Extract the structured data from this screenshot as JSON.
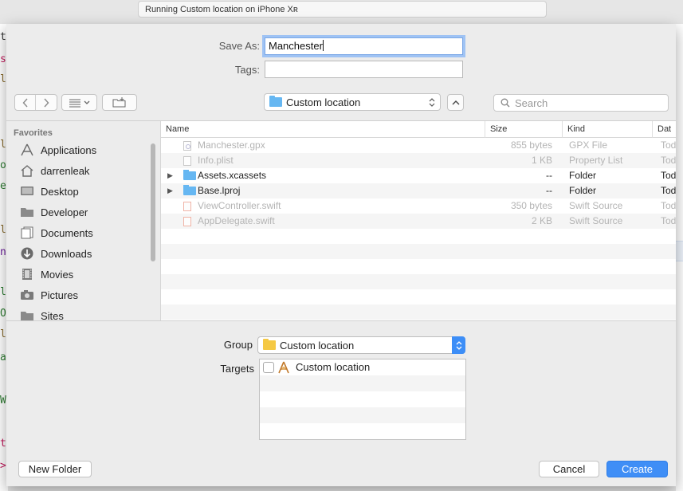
{
  "background_window": {
    "status_text": "Running Custom location on iPhone Xʀ",
    "editor_fragments": [
      "ti",
      "s",
      "lo",
      "",
      "lo",
      "ol",
      "e",
      "",
      "lo",
      "n",
      "",
      "l",
      "Op",
      "la",
      "a",
      "",
      "W",
      "",
      "t",
      ">"
    ]
  },
  "sheet": {
    "save_as_label": "Save As:",
    "save_as_value": "Manchester",
    "tags_label": "Tags:",
    "tags_value": "",
    "location_label": "Custom location",
    "search_placeholder": "Search"
  },
  "sidebar": {
    "heading": "Favorites",
    "items": [
      {
        "label": "Applications",
        "icon": "applications-icon"
      },
      {
        "label": "darrenleak",
        "icon": "home-icon"
      },
      {
        "label": "Desktop",
        "icon": "desktop-icon"
      },
      {
        "label": "Developer",
        "icon": "folder-icon"
      },
      {
        "label": "Documents",
        "icon": "documents-icon"
      },
      {
        "label": "Downloads",
        "icon": "downloads-icon"
      },
      {
        "label": "Movies",
        "icon": "movies-icon"
      },
      {
        "label": "Pictures",
        "icon": "pictures-icon"
      },
      {
        "label": "Sites",
        "icon": "folder-icon"
      }
    ]
  },
  "filelist": {
    "columns": [
      "Name",
      "Size",
      "Kind",
      "Dat"
    ],
    "rows": [
      {
        "name": "Manchester.gpx",
        "size": "855 bytes",
        "kind": "GPX File",
        "date": "Tod",
        "disabled": true,
        "folder": false
      },
      {
        "name": "Info.plist",
        "size": "1 KB",
        "kind": "Property List",
        "date": "Tod",
        "disabled": true,
        "folder": false
      },
      {
        "name": "Assets.xcassets",
        "size": "--",
        "kind": "Folder",
        "date": "Tod",
        "disabled": false,
        "folder": true
      },
      {
        "name": "Base.lproj",
        "size": "--",
        "kind": "Folder",
        "date": "Tod",
        "disabled": false,
        "folder": true
      },
      {
        "name": "ViewController.swift",
        "size": "350 bytes",
        "kind": "Swift Source",
        "date": "Tod",
        "disabled": true,
        "folder": false
      },
      {
        "name": "AppDelegate.swift",
        "size": "2 KB",
        "kind": "Swift Source",
        "date": "Tod",
        "disabled": true,
        "folder": false
      }
    ]
  },
  "accessory": {
    "group_label": "Group",
    "group_value": "Custom location",
    "targets_label": "Targets",
    "targets": [
      {
        "label": "Custom location",
        "checked": false
      }
    ]
  },
  "buttons": {
    "new_folder": "New Folder",
    "cancel": "Cancel",
    "create": "Create"
  }
}
